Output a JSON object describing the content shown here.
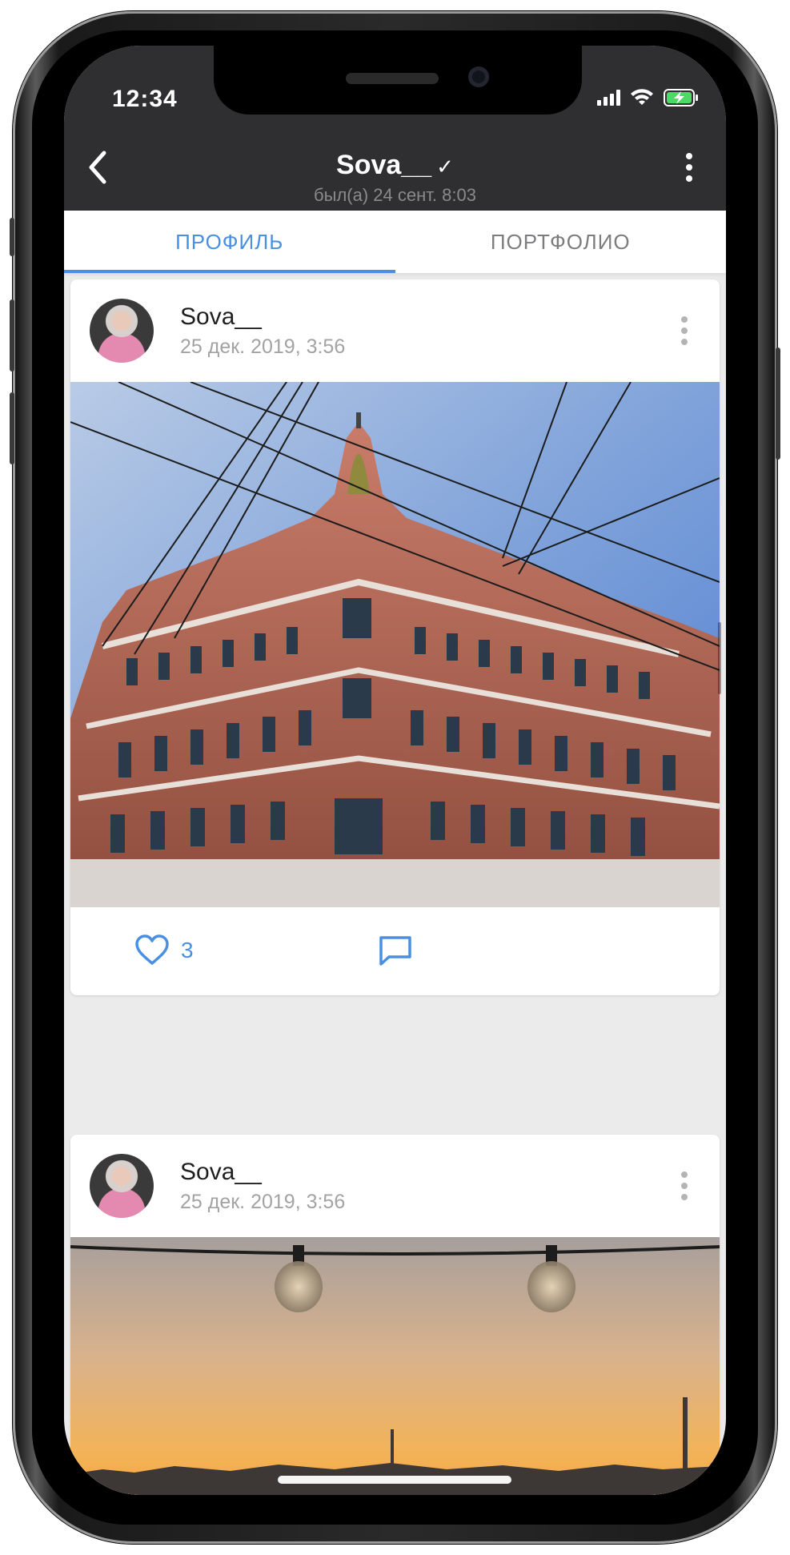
{
  "status_bar": {
    "time": "12:34"
  },
  "header": {
    "title": "Sova__",
    "verified_icon": "checkmark-icon",
    "last_seen": "был(а) 24 сент. 8:03",
    "back_icon": "chevron-left-icon",
    "menu_icon": "more-vertical-icon"
  },
  "tabs": [
    {
      "label": "ПРОФИЛЬ",
      "active": true
    },
    {
      "label": "ПОРТФОЛИО",
      "active": false
    }
  ],
  "posts": [
    {
      "author": "Sova__",
      "date": "25 дек. 2019, 3:56",
      "photo": "photo of ornate red-brick corner building with overhead wires",
      "likes": "3",
      "like_icon": "heart-icon",
      "comment_icon": "comment-icon"
    },
    {
      "author": "Sova__",
      "date": "25 дек. 2019, 3:56",
      "photo": "photo of string light bulbs over a city skyline at sunset"
    }
  ],
  "colors": {
    "accent": "#4a90e2",
    "header_bg": "#2f2f31",
    "battery": "#4cd964"
  }
}
